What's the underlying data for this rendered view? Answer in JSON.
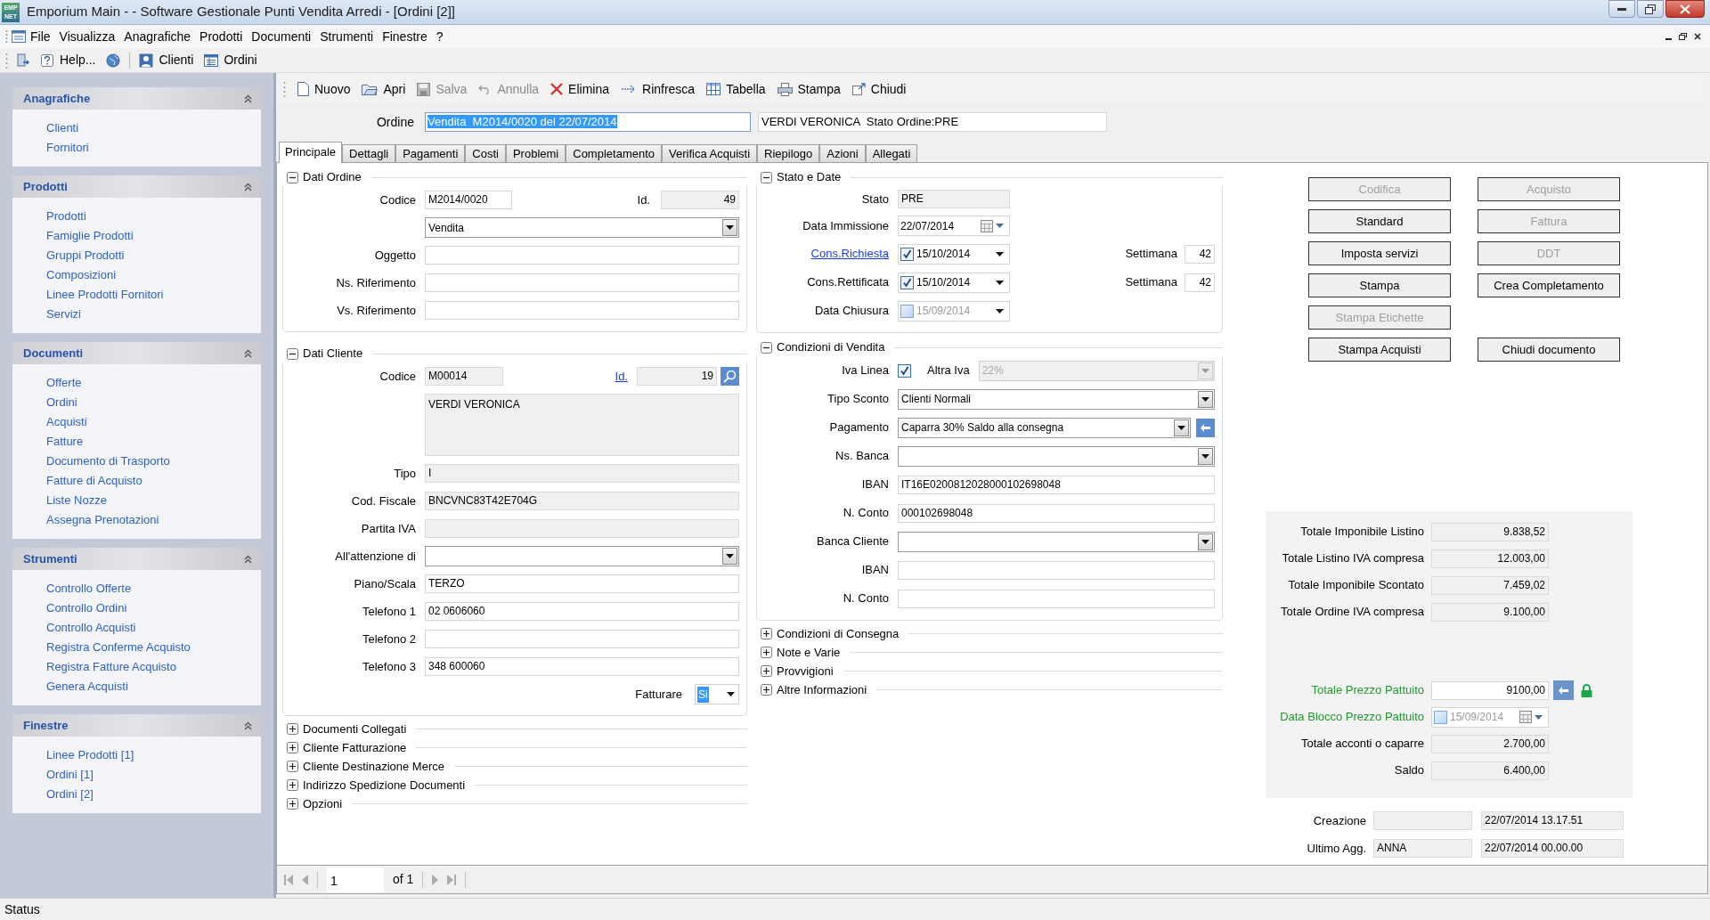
{
  "window": {
    "title": "Emporium Main - - Software Gestionale Punti Vendita Arredi - [Ordini [2]]",
    "logo_lines": [
      "EMP",
      "NET"
    ]
  },
  "menu": [
    "File",
    "Visualizza",
    "Anagrafiche",
    "Prodotti",
    "Documenti",
    "Strumenti",
    "Finestre",
    "?"
  ],
  "toolbar": [
    {
      "label": "Help..."
    },
    {
      "label": "Clienti"
    },
    {
      "label": "Ordini"
    }
  ],
  "sidebar": [
    {
      "title": "Anagrafiche",
      "expanded": true,
      "items": [
        "Clienti",
        "Fornitori"
      ]
    },
    {
      "title": "Prodotti",
      "expanded": true,
      "items": [
        "Prodotti",
        "Famiglie Prodotti",
        "Gruppi Prodotti",
        "Composizioni",
        "Linee Prodotti Fornitori",
        "Servizi"
      ]
    },
    {
      "title": "Documenti",
      "expanded": true,
      "items": [
        "Offerte",
        "Ordini",
        "Acquisti",
        "Fatture",
        "Documento di Trasporto",
        "Fatture di Acquisto",
        "Liste Nozze",
        "Assegna Prenotazioni"
      ]
    },
    {
      "title": "Strumenti",
      "expanded": true,
      "items": [
        "Controllo Offerte",
        "Controllo Ordini",
        "Controllo Acquisti",
        "Registra Conferme Acquisto",
        "Registra Fatture Acquisto",
        "Genera Acquisti"
      ]
    },
    {
      "title": "Finestre",
      "expanded": true,
      "items": [
        "Linee Prodotti [1]",
        "Ordini [1]",
        "Ordini [2]"
      ]
    }
  ],
  "doc_toolbar": [
    {
      "label": "Nuovo",
      "disabled": false
    },
    {
      "label": "Apri",
      "disabled": false
    },
    {
      "label": "Salva",
      "disabled": true
    },
    {
      "label": "Annulla",
      "disabled": true
    },
    {
      "label": "Elimina",
      "disabled": false
    },
    {
      "label": "Rinfresca",
      "disabled": false
    },
    {
      "label": "Tabella",
      "disabled": false
    },
    {
      "label": "Stampa",
      "disabled": false
    },
    {
      "label": "Chiudi",
      "disabled": false
    }
  ],
  "ordine": {
    "label": "Ordine",
    "value": "Vendita  M2014/0020 del 22/07/2014",
    "highlighted": true,
    "summary": "VERDI VERONICA  Stato Ordine:PRE"
  },
  "tabs": [
    {
      "label": "Principale",
      "selected": true
    },
    {
      "label": "Dettagli",
      "selected": false
    },
    {
      "label": "Pagamenti",
      "selected": false
    },
    {
      "label": "Costi",
      "selected": false
    },
    {
      "label": "Problemi",
      "selected": false
    },
    {
      "label": "Completamento",
      "selected": false
    },
    {
      "label": "Verifica Acquisti",
      "selected": false
    },
    {
      "label": "Riepilogo",
      "selected": false
    },
    {
      "label": "Azioni",
      "selected": false
    },
    {
      "label": "Allegati",
      "selected": false
    }
  ],
  "dati_ordine": {
    "title": "Dati Ordine",
    "expanded": true,
    "codice": {
      "label": "Codice",
      "value": "M2014/0020"
    },
    "id": {
      "label": "Id.",
      "value": "49"
    },
    "tipo": "Vendita",
    "fields": [
      {
        "label": "Oggetto"
      },
      {
        "label": "Ns. Riferimento"
      },
      {
        "label": "Vs. Riferimento"
      }
    ]
  },
  "dati_cliente": {
    "title": "Dati Cliente",
    "expanded": true,
    "codice": {
      "label": "Codice",
      "value": "M00014"
    },
    "id": {
      "label": "Id.",
      "value": "19"
    },
    "nome": "VERDI VERONICA",
    "fields": [
      {
        "label": "Tipo",
        "value": "I",
        "kind": "readonly"
      },
      {
        "label": "Cod. Fiscale",
        "value": "BNCVNC83T42E704G",
        "kind": "readonly"
      },
      {
        "label": "Partita IVA",
        "kind": "readonly"
      },
      {
        "label": "All'attenzione di",
        "kind": "combo"
      },
      {
        "label": "Piano/Scala",
        "value": "TERZO",
        "kind": "input"
      },
      {
        "label": "Telefono 1",
        "value": "02 0606060",
        "kind": "input"
      },
      {
        "label": "Telefono 2",
        "kind": "input"
      },
      {
        "label": "Telefono 3",
        "value": "348 600060",
        "kind": "input"
      }
    ],
    "fatturare": {
      "label": "Fatturare",
      "value": "Si",
      "highlighted": true
    }
  },
  "left_sections": [
    {
      "title": "Documenti Collegati",
      "expanded": false
    },
    {
      "title": "Cliente Fatturazione",
      "expanded": false
    },
    {
      "title": "Cliente Destinazione Merce",
      "expanded": false
    },
    {
      "title": "Indirizzo Spedizione Documenti",
      "expanded": false
    },
    {
      "title": "Opzioni",
      "expanded": false
    }
  ],
  "stato_e_date": {
    "title": "Stato e Date",
    "expanded": true,
    "stato": {
      "label": "Stato",
      "value": "PRE"
    },
    "data_immissione": {
      "label": "Data Immissione",
      "value": "22/07/2014"
    },
    "dates": [
      {
        "label": "Cons.Richiesta",
        "link": true,
        "checked": true,
        "value": "15/10/2014",
        "week_label": "Settimana",
        "week": "42"
      },
      {
        "label": "Cons.Rettificata",
        "link": false,
        "checked": true,
        "value": "15/10/2014",
        "week_label": "Settimana",
        "week": "42"
      },
      {
        "label": "Data Chiusura",
        "link": false,
        "checked": false,
        "value": "15/09/2014"
      }
    ]
  },
  "condizioni_vendita": {
    "title": "Condizioni di Vendita",
    "expanded": true,
    "iva_linea": {
      "label": "Iva Linea",
      "checked": true
    },
    "altra_iva": {
      "label": "Altra Iva",
      "value": "22%",
      "disabled": true
    },
    "fields": [
      {
        "label": "Tipo Sconto",
        "value": "Clienti Normali",
        "kind": "combo"
      },
      {
        "label": "Pagamento",
        "value": "Caparra 30% Saldo alla consegna",
        "kind": "combo_button"
      },
      {
        "label": "Ns. Banca",
        "kind": "combo"
      },
      {
        "label": "IBAN",
        "value": "IT16E0200812028000102698048",
        "kind": "input"
      },
      {
        "label": "N. Conto",
        "value": "000102698048",
        "kind": "input"
      },
      {
        "label": "Banca Cliente",
        "kind": "combo"
      },
      {
        "label": "IBAN",
        "kind": "input"
      },
      {
        "label": "N. Conto",
        "kind": "input"
      }
    ]
  },
  "right_sections": [
    {
      "title": "Condizioni di Consegna",
      "expanded": false
    },
    {
      "title": "Note e Varie",
      "expanded": false
    },
    {
      "title": "Provvigioni",
      "expanded": false
    },
    {
      "title": "Altre Informazioni",
      "expanded": false
    }
  ],
  "actions": [
    [
      {
        "label": "Codifica",
        "disabled": true
      },
      {
        "label": "Acquisto",
        "disabled": true
      }
    ],
    [
      {
        "label": "Standard",
        "disabled": false
      },
      {
        "label": "Fattura",
        "disabled": true
      }
    ],
    [
      {
        "label": "Imposta servizi",
        "disabled": false
      },
      {
        "label": "DDT",
        "disabled": true
      }
    ],
    [
      {
        "label": "Stampa",
        "disabled": false
      },
      {
        "label": "Crea Completamento",
        "disabled": false
      }
    ],
    [
      {
        "label": "Stampa Etichette",
        "disabled": true
      }
    ],
    [
      {
        "label": "Stampa Acquisti",
        "disabled": false
      },
      {
        "label": "Chiudi documento",
        "disabled": false
      }
    ]
  ],
  "totals": [
    {
      "label": "Totale Imponibile Listino",
      "value": "9.838,52"
    },
    {
      "label": "Totale Listino IVA compresa",
      "value": "12.003,00"
    },
    {
      "label": "Totale Imponibile Scontato",
      "value": "7.459,02"
    },
    {
      "label": "Totale Ordine IVA compresa",
      "value": "9.100,00"
    }
  ],
  "agreed": [
    {
      "kind": "price",
      "label": "Totale Prezzo Pattuito",
      "value": "9100,00",
      "locked": true
    },
    {
      "kind": "date",
      "label": "Data Blocco Prezzo Pattuito",
      "value": "15/09/2014",
      "checked": false
    },
    {
      "kind": "readonly",
      "label": "Totale acconti o caparre",
      "value": "2.700,00"
    },
    {
      "kind": "readonly",
      "label": "Saldo",
      "value": "6.400,00"
    }
  ],
  "audit": [
    {
      "label": "Creazione",
      "time": "22/07/2014 13.17.51"
    },
    {
      "label": "Ultimo Agg.",
      "user": "ANNA",
      "time": "22/07/2014 00.00.00"
    }
  ],
  "pager": {
    "page": "1",
    "of": "of 1"
  },
  "status_bar": "Status"
}
